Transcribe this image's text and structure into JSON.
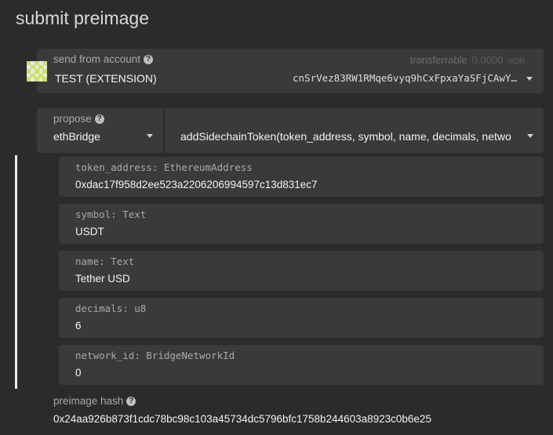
{
  "page": {
    "title": "submit preimage"
  },
  "account": {
    "label": "send from account",
    "name": "TEST (EXTENSION)",
    "transferrable_label": "transferrable",
    "balance": "0.0000",
    "unit": "XOR",
    "address": "cnSrVez83RW1RMqe6vyq9hCxFpxaYaSFjCAwY…",
    "icon": "identicon-icon"
  },
  "propose": {
    "label": "propose",
    "section": "ethBridge",
    "method": "addSidechainToken(token_address, symbol, name, decimals, netwo"
  },
  "params": [
    {
      "label": "token_address: EthereumAddress",
      "value": "0xdac17f958d2ee523a2206206994597c13d831ec7"
    },
    {
      "label": "symbol: Text",
      "value": "USDT"
    },
    {
      "label": "name: Text",
      "value": "Tether USD"
    },
    {
      "label": "decimals: u8",
      "value": "6"
    },
    {
      "label": "network_id: BridgeNetworkId",
      "value": "0"
    }
  ],
  "hash": {
    "label": "preimage hash",
    "value": "0x24aa926b873f1cdc78bc98c103a45734dc5796bfc1758b244603a8923c0b6e25"
  }
}
